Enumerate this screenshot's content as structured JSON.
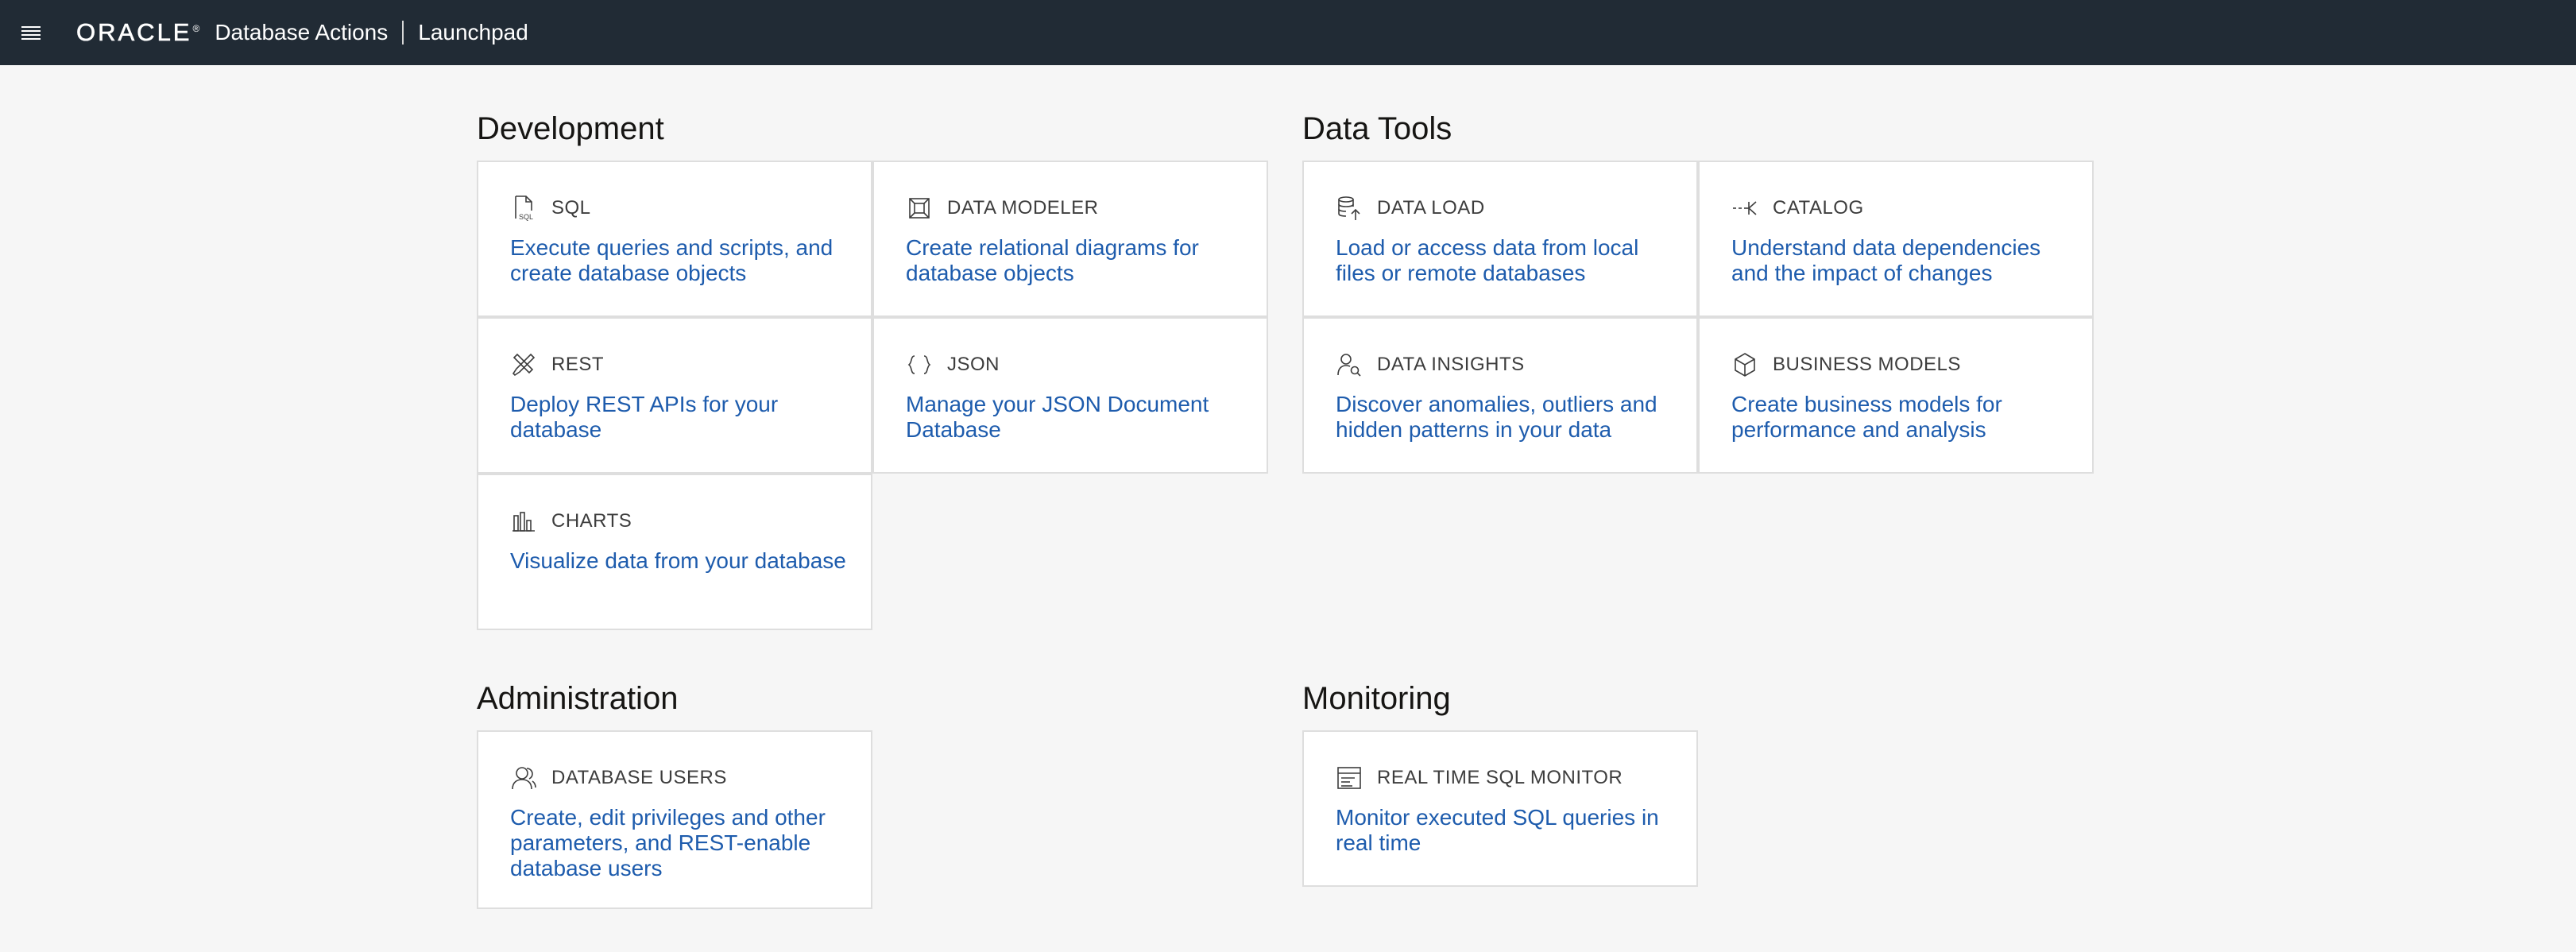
{
  "header": {
    "logo_text": "ORACLE",
    "logo_reg": "®",
    "app_name": "Database Actions",
    "page_name": "Launchpad",
    "background_color": "#212b35"
  },
  "sections": {
    "development": {
      "title": "Development",
      "tiles": {
        "sql": {
          "title": "SQL",
          "description": "Execute queries and scripts, and create database objects",
          "icon": "sql-file-icon"
        },
        "data_modeler": {
          "title": "DATA MODELER",
          "description": "Create relational diagrams for database objects",
          "icon": "data-modeler-icon"
        },
        "rest": {
          "title": "REST",
          "description": "Deploy REST APIs for your database",
          "icon": "rest-tools-icon"
        },
        "json": {
          "title": "JSON",
          "description": "Manage your JSON Document Database",
          "icon": "json-braces-icon"
        },
        "charts": {
          "title": "CHARTS",
          "description": "Visualize data from your database",
          "icon": "bar-chart-icon"
        }
      }
    },
    "data_tools": {
      "title": "Data Tools",
      "tiles": {
        "data_load": {
          "title": "DATA LOAD",
          "description": "Load or access data from local files or remote databases",
          "icon": "database-upload-icon"
        },
        "catalog": {
          "title": "CATALOG",
          "description": "Understand data dependencies and the impact of changes",
          "icon": "lineage-icon"
        },
        "data_insights": {
          "title": "DATA INSIGHTS",
          "description": "Discover anomalies, outliers and hidden patterns in your data",
          "icon": "user-search-icon"
        },
        "business_models": {
          "title": "BUSINESS MODELS",
          "description": "Create business models for performance and analysis",
          "icon": "cube-icon"
        }
      }
    },
    "administration": {
      "title": "Administration",
      "tiles": {
        "database_users": {
          "title": "DATABASE USERS",
          "description": "Create, edit privileges and other parameters, and REST-enable database users",
          "icon": "users-icon"
        }
      }
    },
    "monitoring": {
      "title": "Monitoring",
      "tiles": {
        "sql_monitor": {
          "title": "REAL TIME SQL MONITOR",
          "description": "Monitor executed SQL queries in real time",
          "icon": "monitor-list-icon"
        }
      }
    }
  },
  "colors": {
    "page_background": "#f6f6f6",
    "tile_background": "#ffffff",
    "tile_border": "#dedede",
    "link_blue": "#1e5cad",
    "tile_title": "#3d3d3d"
  }
}
